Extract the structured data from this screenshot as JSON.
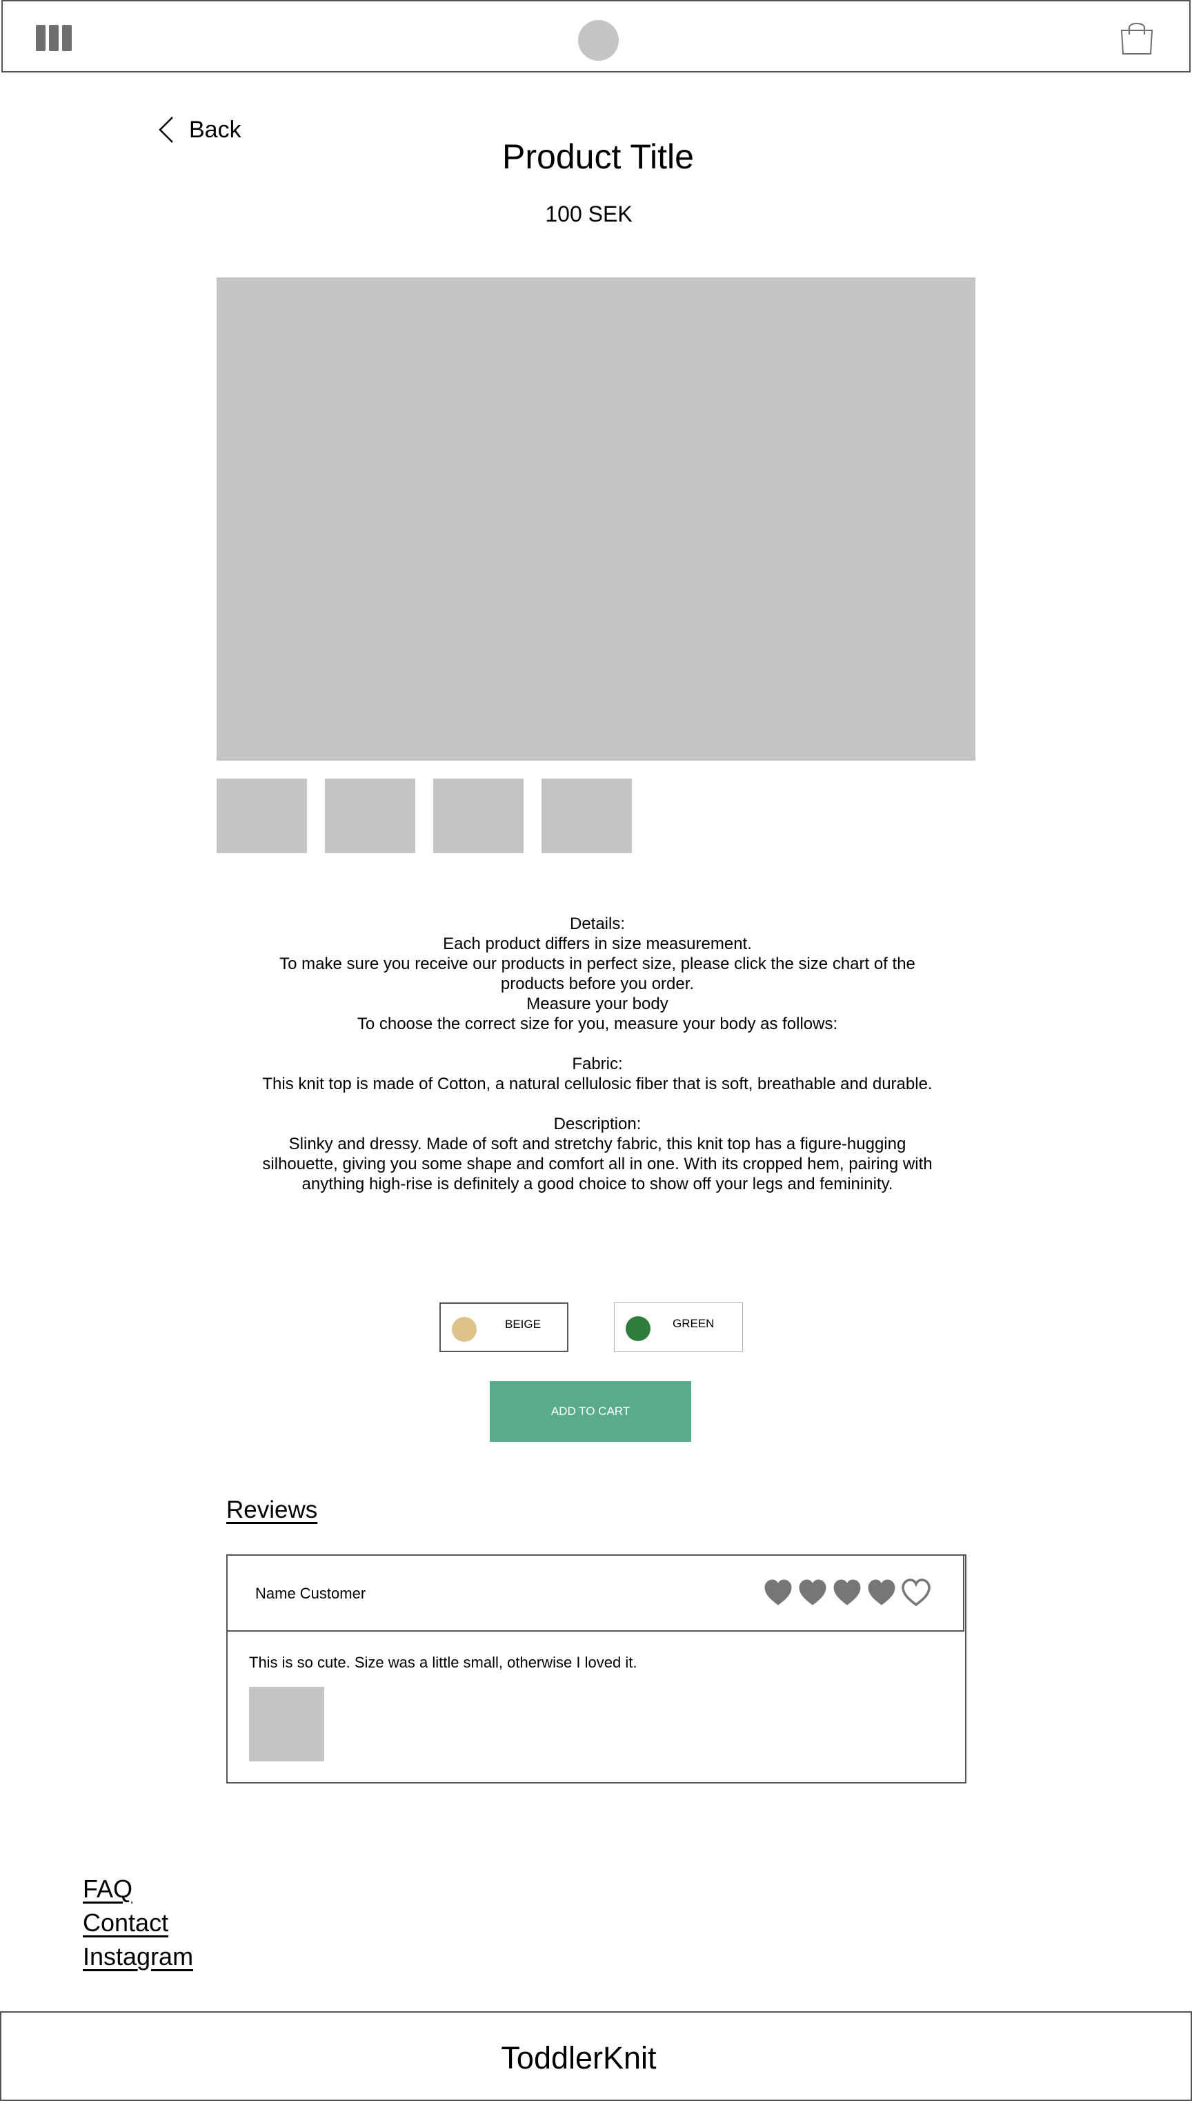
{
  "header": {
    "menu_icon": "menu-icon",
    "logo_icon": "logo-placeholder-circle",
    "cart_icon": "shopping-bag-icon"
  },
  "nav": {
    "back_label": "Back",
    "back_icon": "chevron-left-icon"
  },
  "product": {
    "title": "Product Title",
    "price": "100 SEK",
    "details_heading": "Details:",
    "details_lines": [
      "Each product differs in size measurement.",
      "To make sure you receive our products in perfect size, please click the size chart of the products before you order.",
      "Measure your body",
      "To choose the correct size for you, measure your body as follows:"
    ],
    "fabric_heading": "Fabric:",
    "fabric_text": "This knit top is made of Cotton, a natural cellulosic fiber that is soft, breathable and durable.",
    "description_heading": "Description:",
    "description_text": "Slinky and dressy. Made of soft and stretchy fabric, this knit top has a figure-hugging silhouette, giving you some shape and comfort all in one. With its cropped hem, pairing with anything high-rise is definitely a good choice to show off your legs and femininity."
  },
  "colors": [
    {
      "label": "BEIGE",
      "color": "#dcc28a",
      "selected": true
    },
    {
      "label": "GREEN",
      "color": "#2e7d3a",
      "selected": false
    }
  ],
  "add_to_cart_label": "ADD TO CART",
  "add_to_cart_color": "#5aab8c",
  "reviews": {
    "heading": "Reviews",
    "items": [
      {
        "customer": "Name Customer",
        "rating": 4,
        "max_rating": 5,
        "rating_icon": "heart-icon",
        "text": "This is so cute. Size was a little small, otherwise I loved it."
      }
    ]
  },
  "footer_links": [
    "FAQ",
    "Contact",
    "Instagram"
  ],
  "footer": {
    "brand": "ToddlerKnit"
  }
}
